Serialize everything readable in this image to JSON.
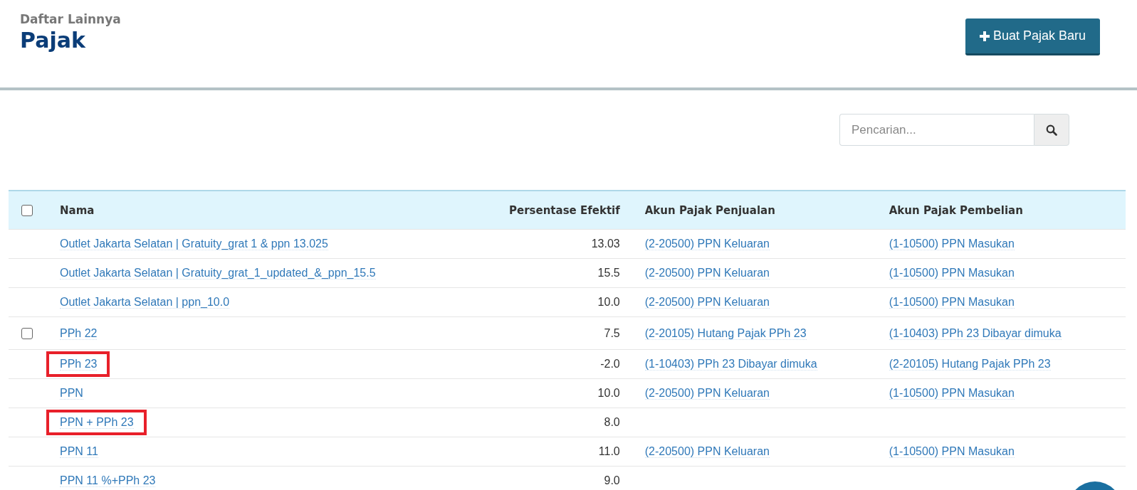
{
  "header": {
    "subtitle": "Daftar Lainnya",
    "title": "Pajak",
    "create_button": "Buat Pajak Baru"
  },
  "search": {
    "placeholder": "Pencarian..."
  },
  "table": {
    "select_all": {
      "checked": false
    },
    "columns": [
      "Nama",
      "Persentase Efektif",
      "Akun Pajak Penjualan",
      "Akun Pajak Pembelian"
    ],
    "rows": [
      {
        "name": "Outlet Jakarta Selatan | Gratuity_grat 1 & ppn 13.025",
        "rate": "13.03",
        "sales_account": "(2-20500) PPN Keluaran",
        "purchase_account": "(1-10500) PPN Masukan",
        "hovered": false,
        "highlighted": false
      },
      {
        "name": "Outlet Jakarta Selatan | Gratuity_grat_1_updated_&_ppn_15.5",
        "rate": "15.5",
        "sales_account": "(2-20500) PPN Keluaran",
        "purchase_account": "(1-10500) PPN Masukan",
        "hovered": false,
        "highlighted": false
      },
      {
        "name": "Outlet Jakarta Selatan | ppn_10.0",
        "rate": "10.0",
        "sales_account": "(2-20500) PPN Keluaran",
        "purchase_account": "(1-10500) PPN Masukan",
        "hovered": false,
        "highlighted": false
      },
      {
        "name": "PPh 22",
        "rate": "7.5",
        "sales_account": "(2-20105) Hutang Pajak PPh 23",
        "purchase_account": "(1-10403) PPh 23 Dibayar dimuka",
        "hovered": true,
        "highlighted": false
      },
      {
        "name": "PPh 23",
        "rate": "-2.0",
        "sales_account": "(1-10403) PPh 23 Dibayar dimuka",
        "purchase_account": "(2-20105) Hutang Pajak PPh 23",
        "hovered": false,
        "highlighted": true
      },
      {
        "name": "PPN",
        "rate": "10.0",
        "sales_account": "(2-20500) PPN Keluaran",
        "purchase_account": "(1-10500) PPN Masukan",
        "hovered": false,
        "highlighted": false
      },
      {
        "name": "PPN + PPh 23",
        "rate": "8.0",
        "hovered": false,
        "highlighted": true
      },
      {
        "name": "PPN 11",
        "rate": "11.0",
        "sales_account": "(2-20500) PPN Keluaran",
        "purchase_account": "(1-10500) PPN Masukan",
        "hovered": false,
        "highlighted": false
      },
      {
        "name": "PPN 11 %+PPh 23",
        "rate": "9.0",
        "hovered": false,
        "highlighted": false
      }
    ]
  }
}
